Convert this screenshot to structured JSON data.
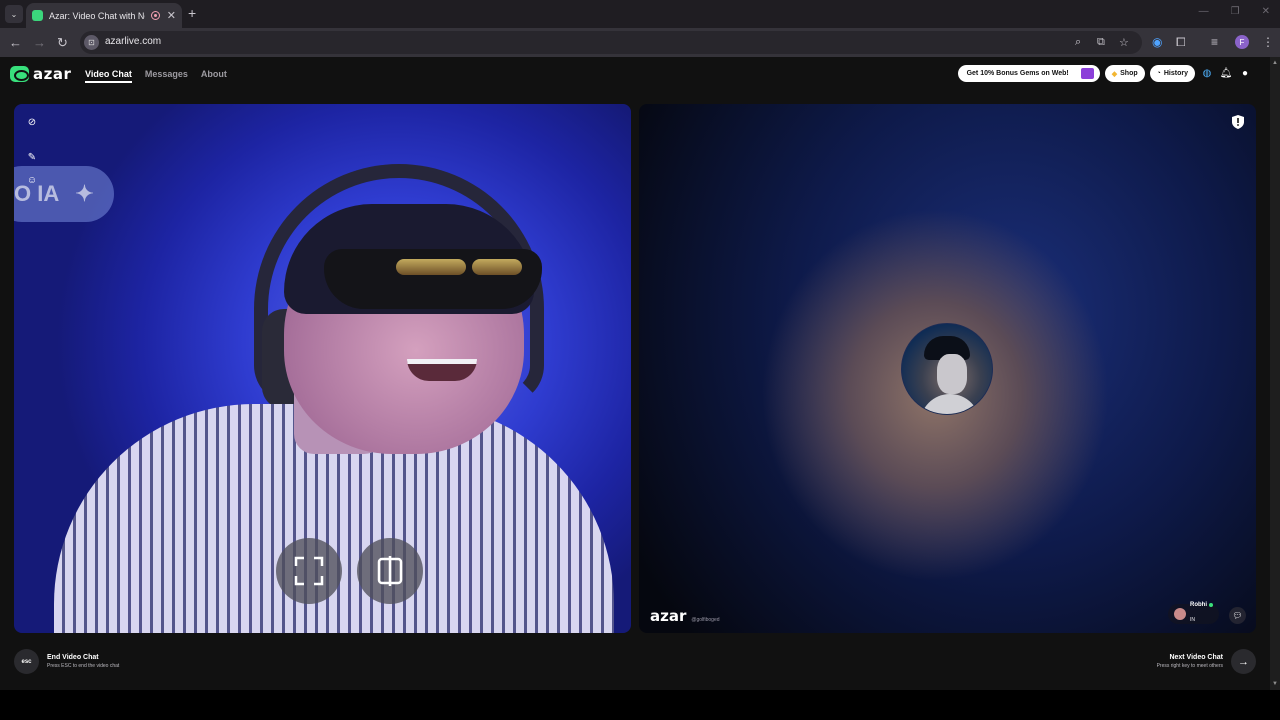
{
  "browser": {
    "tab_title": "Azar: Video Chat with New",
    "url": "azarlive.com",
    "new_tab": "+",
    "tab_close": "✕",
    "profile_initial": "F",
    "site_chip": "⊡"
  },
  "site": {
    "logo_text": "azar",
    "nav": [
      {
        "label": "Video Chat",
        "active": true
      },
      {
        "label": "Messages",
        "active": false
      },
      {
        "label": "About",
        "active": false
      }
    ],
    "promo_label": "Get 10% Bonus Gems on Web!",
    "shop_label": "Shop",
    "history_label": "History"
  },
  "local_video": {
    "overlay_text": "O IA"
  },
  "remote_video": {
    "watermark": "azar",
    "watermark_handle": "@golfiboged",
    "partner_name": "Robhi",
    "partner_country": "IN"
  },
  "footer": {
    "end_key": "esc",
    "end_title": "End Video Chat",
    "end_hint": "Press ESC to end the video chat",
    "next_title": "Next Video Chat",
    "next_hint": "Press right key to meet others"
  },
  "colors": {
    "accent": "#38e07c",
    "page_bg": "#111111",
    "online": "#3be07b"
  }
}
